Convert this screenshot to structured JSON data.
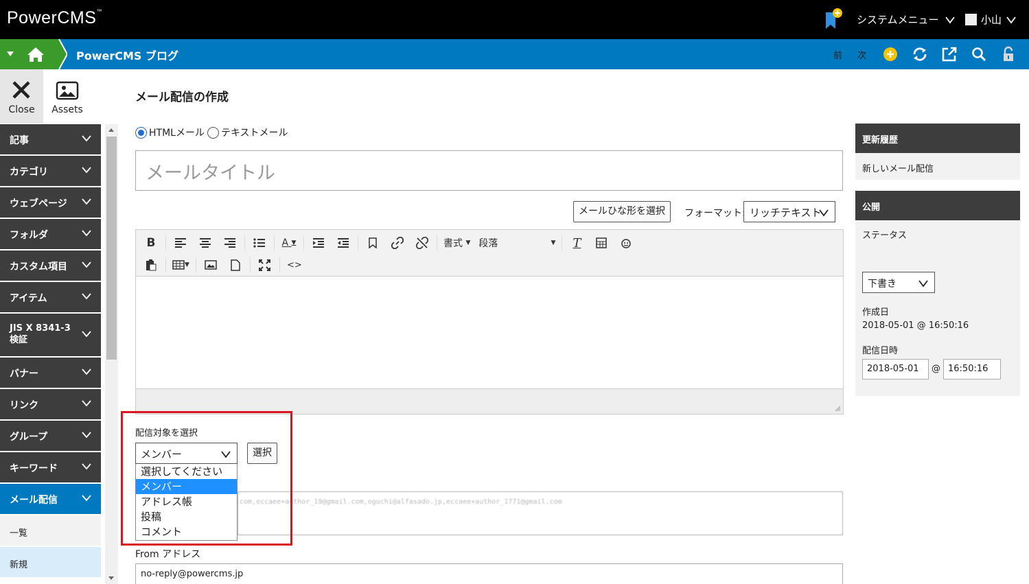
{
  "app": {
    "logo": "PowerCMS",
    "logo_tm": "™",
    "system_menu": "システムメニュー",
    "user": "小山"
  },
  "nav": {
    "site_title": "PowerCMS ブログ",
    "prev": "前",
    "next": "次"
  },
  "tools": {
    "close": "Close",
    "assets": "Assets"
  },
  "sidebar": {
    "items": [
      {
        "label": "記事"
      },
      {
        "label": "カテゴリ"
      },
      {
        "label": "ウェブページ"
      },
      {
        "label": "フォルダ"
      },
      {
        "label": "カスタム項目"
      },
      {
        "label": "アイテム"
      },
      {
        "label_line1": "JIS X 8341-3",
        "label_line2": "検証"
      },
      {
        "label": "バナー"
      },
      {
        "label": "リンク"
      },
      {
        "label": "グループ"
      },
      {
        "label": "キーワード"
      },
      {
        "label": "メール配信"
      }
    ],
    "subitems": [
      {
        "label": "一覧"
      },
      {
        "label": "新規"
      }
    ]
  },
  "main": {
    "page_title": "メール配信の作成",
    "radio_html": "HTMLメール",
    "radio_text": "テキストメール",
    "title_placeholder": "メールタイトル",
    "template_button": "メールひな形を選択",
    "format_label": "フォーマット:",
    "format_value": "リッチテキスト",
    "toolbar": {
      "styles": "書式",
      "paragraph": "段落",
      "text_color": "A"
    },
    "target": {
      "label": "配信対象を選択",
      "selected": "メンバー",
      "select_button": "選択",
      "options": [
        "選択してください",
        "メンバー",
        "アドレス帳",
        "投稿",
        "コメント"
      ]
    },
    "recipients_blurred": "com,eccaee+author_19@gmail.com,oguchi@alfasado.jp,eccaee+author_1771@gmail.com",
    "from_label": "From アドレス",
    "from_value": "no-reply@powercms.jp"
  },
  "right": {
    "history_title": "更新履歴",
    "history_item": "新しいメール配信",
    "publish_title": "公開",
    "status_label": "ステータス",
    "status_value": "下書き",
    "created_label": "作成日",
    "created_value": "2018-05-01 @ 16:50:16",
    "send_label": "配信日時",
    "send_date": "2018-05-01",
    "at": "@",
    "send_time": "16:50:16"
  },
  "colors": {
    "nav_blue": "#0079c1",
    "nav_green": "#3a9a2a",
    "sidebar_dark": "#3d3d3d",
    "highlight_red": "#d9151d",
    "accent_yellow": "#f5c400"
  }
}
